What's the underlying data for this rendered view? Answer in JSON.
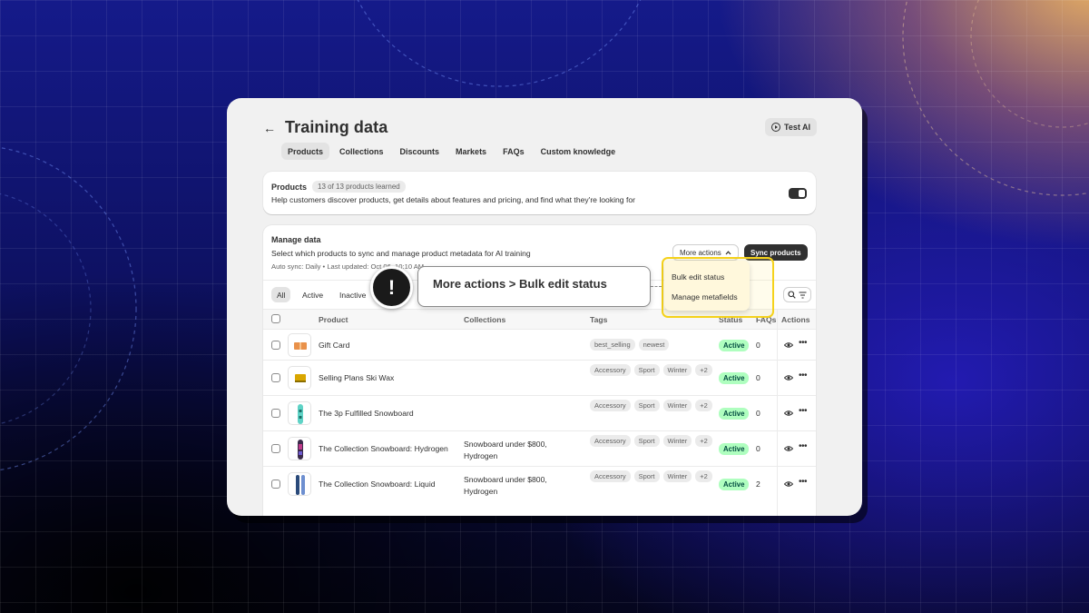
{
  "header": {
    "back_icon": "arrow-left-icon",
    "title": "Training data",
    "test_ai_label": "Test AI"
  },
  "tabs": [
    "Products",
    "Collections",
    "Discounts",
    "Markets",
    "FAQs",
    "Custom knowledge"
  ],
  "products_card": {
    "title": "Products",
    "badge": "13 of 13 products learned",
    "description": "Help customers discover products, get details about features and pricing, and find what they're looking for",
    "toggle_on": true
  },
  "manage": {
    "title": "Manage data",
    "description": "Select which products to sync and manage product metadata for AI training",
    "auto_sync": "Auto sync: Daily • Last updated: Oct 06, 10:10 AM",
    "more_actions_label": "More actions",
    "sync_label": "Sync products"
  },
  "filters": [
    "All",
    "Active",
    "Inactive"
  ],
  "table": {
    "headers": {
      "product": "Product",
      "collections": "Collections",
      "tags": "Tags",
      "status": "Status",
      "faqs": "FAQs",
      "actions": "Actions"
    },
    "rows": [
      {
        "name": "Gift Card",
        "collections": "",
        "tags": [
          "best_selling",
          "newest"
        ],
        "status": "Active",
        "faqs": "0"
      },
      {
        "name": "Selling Plans Ski Wax",
        "collections": "",
        "tags": [
          "Accessory",
          "Sport",
          "Winter",
          "+2"
        ],
        "status": "Active",
        "faqs": "0"
      },
      {
        "name": "The 3p Fulfilled Snowboard",
        "collections": "",
        "tags": [
          "Accessory",
          "Sport",
          "Winter",
          "+2"
        ],
        "status": "Active",
        "faqs": "0"
      },
      {
        "name": "The Collection Snowboard: Hydrogen",
        "collections": "Snowboard under $800, Hydrogen",
        "tags": [
          "Accessory",
          "Sport",
          "Winter",
          "+2"
        ],
        "status": "Active",
        "faqs": "0"
      },
      {
        "name": "The Collection Snowboard: Liquid",
        "collections": "Snowboard under $800, Hydrogen",
        "tags": [
          "Accessory",
          "Sport",
          "Winter",
          "+2"
        ],
        "status": "Active",
        "faqs": "2"
      }
    ]
  },
  "dropdown": {
    "items": [
      "Bulk edit status",
      "Manage metafields"
    ]
  },
  "annotation": {
    "icon": "!",
    "text": "More actions > Bulk edit status"
  },
  "colors": {
    "status_bg": "#affebf",
    "highlight": "#f5d21b",
    "primary_button": "#303030"
  }
}
